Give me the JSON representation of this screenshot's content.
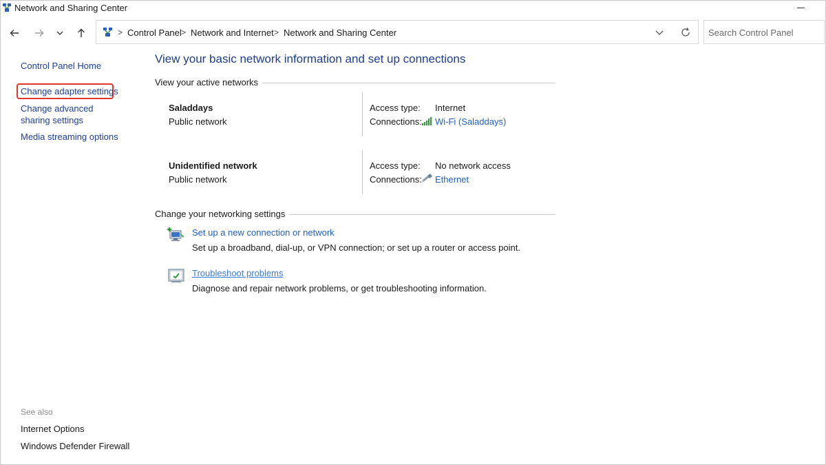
{
  "window": {
    "title": "Network and Sharing Center"
  },
  "address_bar": {
    "breadcrumbs": [
      "Control Panel",
      "Network and Internet",
      "Network and Sharing Center"
    ]
  },
  "search": {
    "placeholder": "Search Control Panel"
  },
  "sidebar": {
    "links": [
      {
        "label": "Control Panel Home"
      },
      {
        "label": "Change adapter settings",
        "highlighted": true
      },
      {
        "label": "Change advanced sharing settings"
      },
      {
        "label": "Media streaming options"
      }
    ],
    "see_also_title": "See also",
    "see_also_links": [
      {
        "label": "Internet Options"
      },
      {
        "label": "Windows Defender Firewall"
      }
    ]
  },
  "main": {
    "title": "View your basic network information and set up connections",
    "active_networks_heading": "View your active networks",
    "networks": [
      {
        "name": "Saladdays",
        "type": "Public network",
        "access_label": "Access type:",
        "access_value": "Internet",
        "connections_label": "Connections:",
        "connection": "Wi-Fi (Saladdays)",
        "connection_icon": "wifi-signal-icon"
      },
      {
        "name": "Unidentified network",
        "type": "Public network",
        "access_label": "Access type:",
        "access_value": "No network access",
        "connections_label": "Connections:",
        "connection": "Ethernet",
        "connection_icon": "ethernet-cable-icon"
      }
    ],
    "settings_heading": "Change your networking settings",
    "tasks": [
      {
        "link": "Set up a new connection or network",
        "description": "Set up a broadband, dial-up, or VPN connection; or set up a router or access point.",
        "icon": "new-connection-icon"
      },
      {
        "link": "Troubleshoot problems",
        "description": "Diagnose and repair network problems, or get troubleshooting information.",
        "icon": "troubleshoot-icon"
      }
    ]
  },
  "colors": {
    "accent_title": "#1e3c8c",
    "link": "#1f5fbf",
    "highlight_box": "#e0362c"
  }
}
